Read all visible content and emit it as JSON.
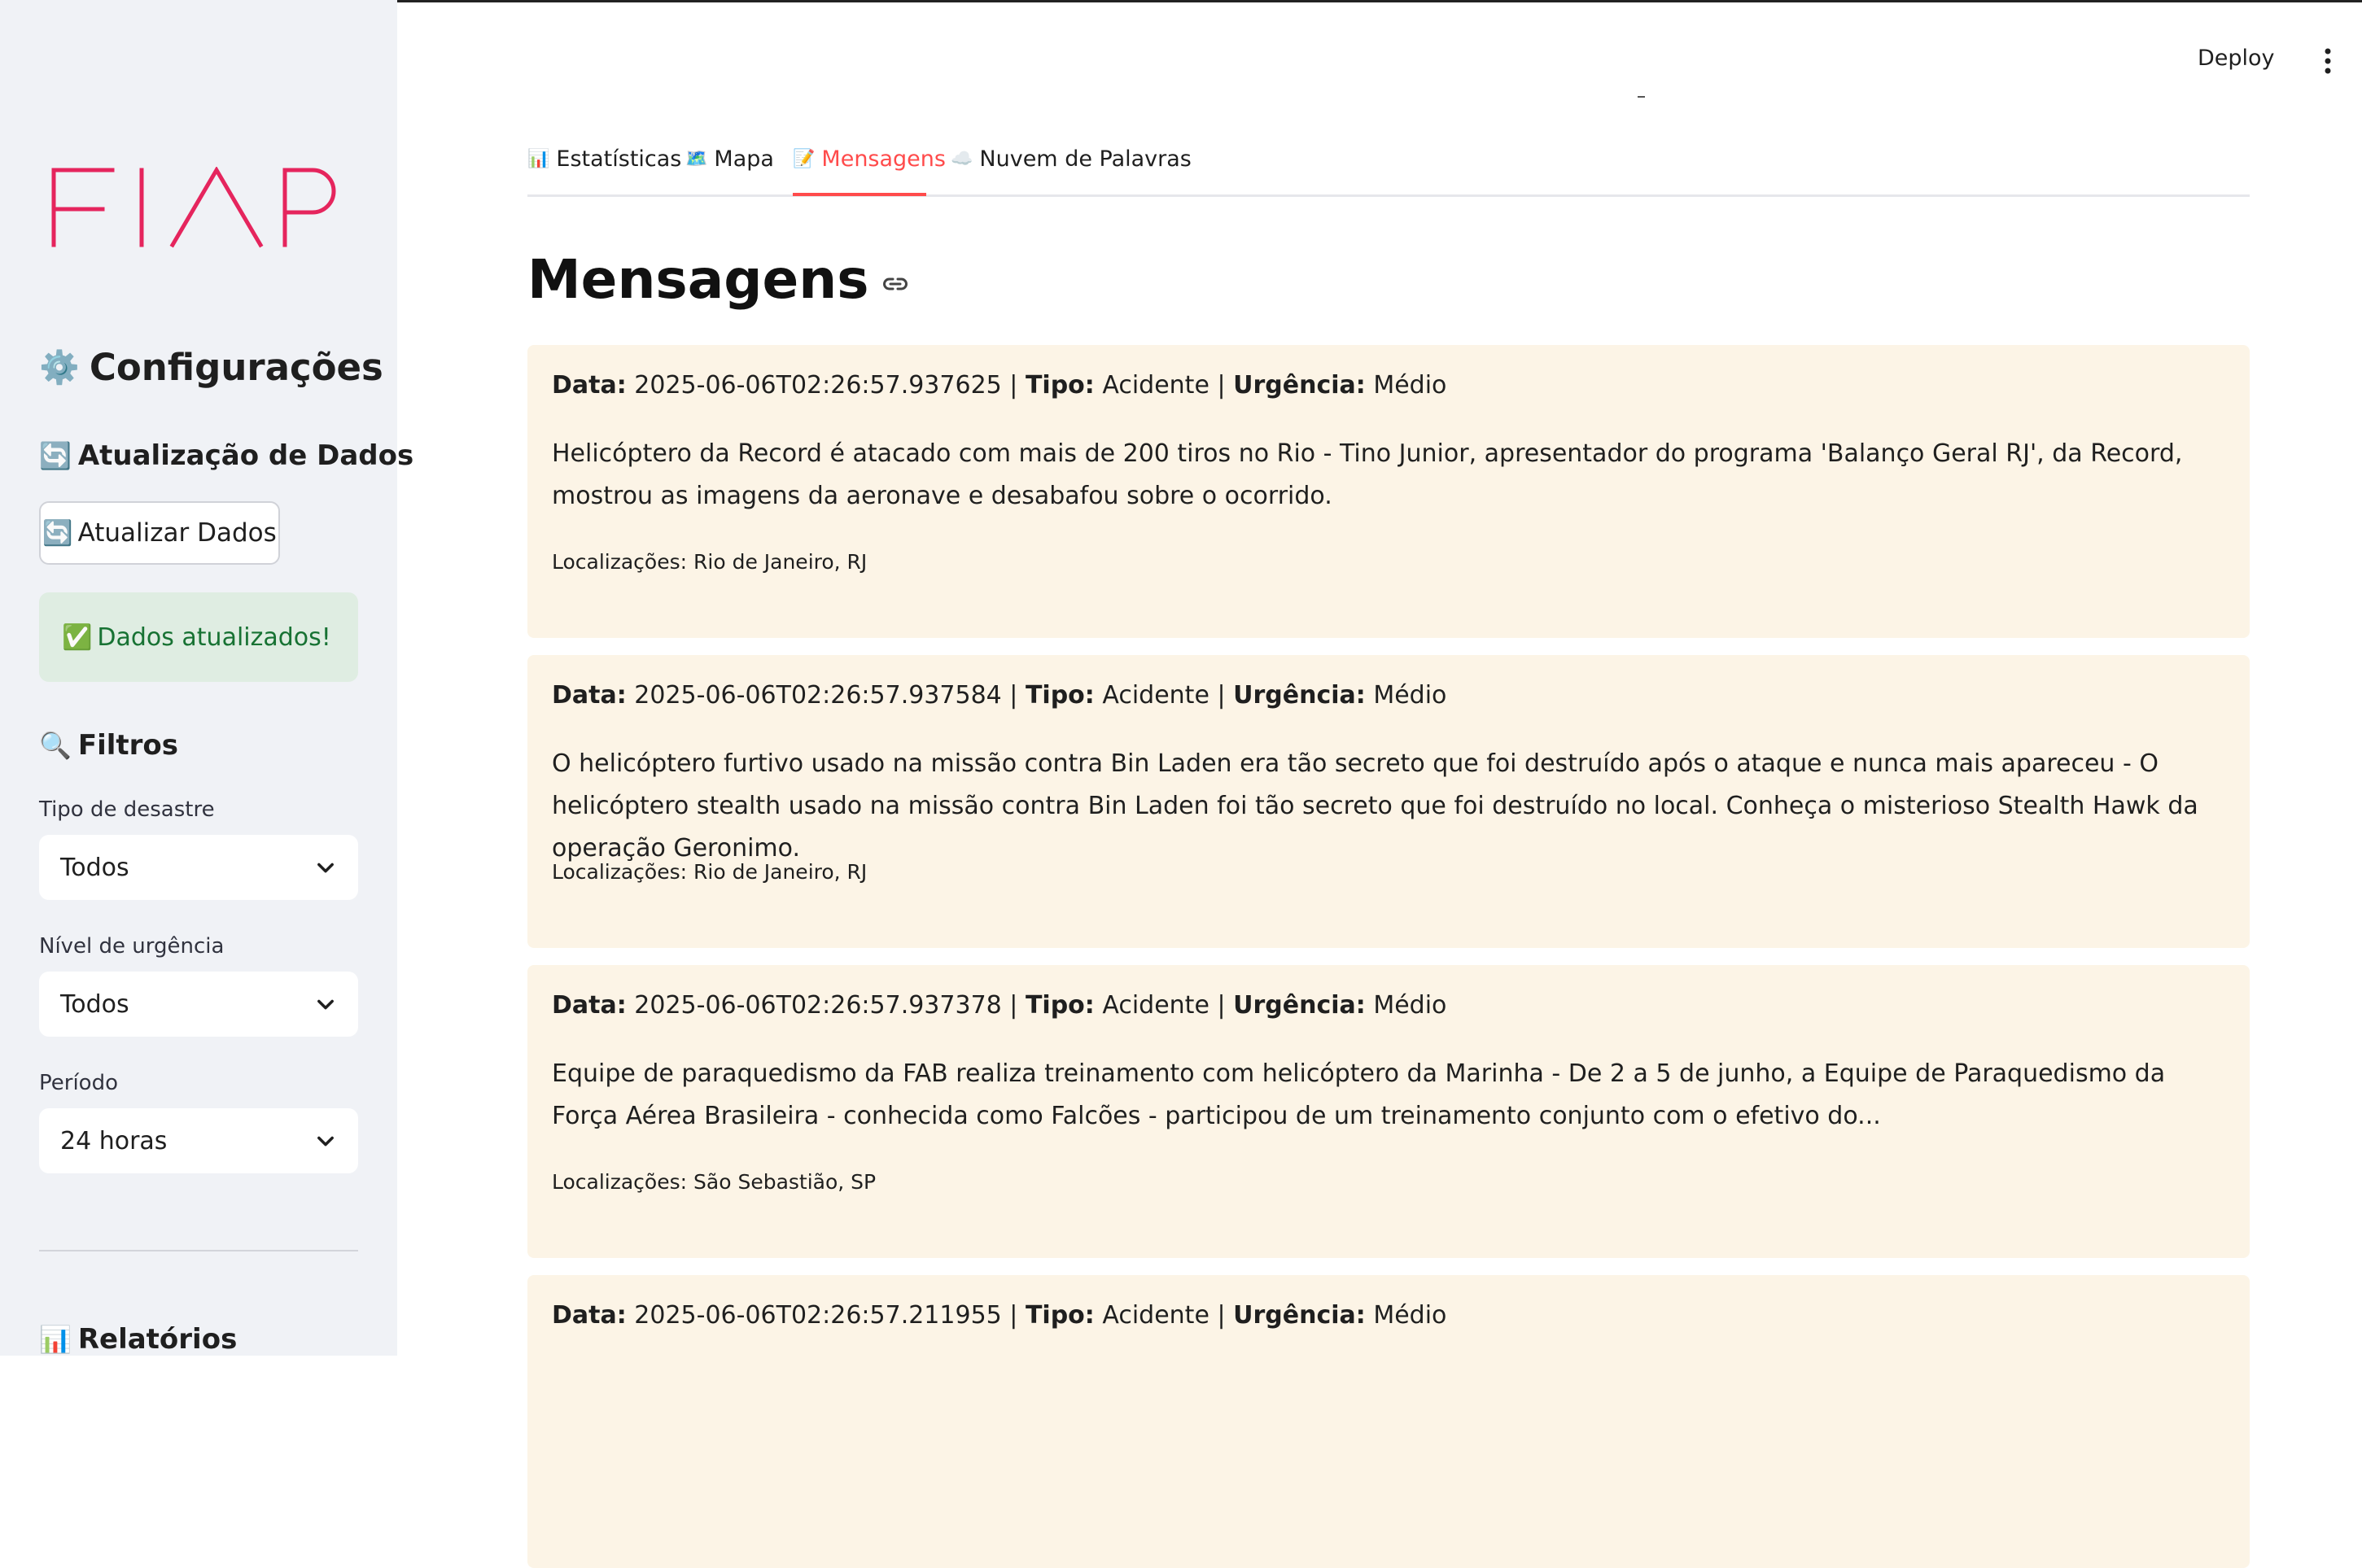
{
  "header": {
    "deploy_label": "Deploy",
    "menu_icon": "kebab-menu-icon"
  },
  "brand": {
    "logo_text": "FIAP",
    "logo_color": "#e5255d"
  },
  "sidebar": {
    "title": "Configurações",
    "title_icon": "⚙️",
    "update_section": {
      "icon": "🔄",
      "title": "Atualização de Dados"
    },
    "refresh_button": {
      "icon": "🔄",
      "label": "Atualizar Dados"
    },
    "success_alert": {
      "icon": "✅",
      "text": "Dados atualizados!"
    },
    "filters_section": {
      "icon": "🔍",
      "title": "Filtros"
    },
    "filters": [
      {
        "label": "Tipo de desastre",
        "value": "Todos"
      },
      {
        "label": "Nível de urgência",
        "value": "Todos"
      },
      {
        "label": "Período",
        "value": "24 horas"
      }
    ],
    "reports_section": {
      "icon": "📊",
      "title": "Relatórios"
    }
  },
  "tabs": [
    {
      "icon": "📊",
      "label": "Estatísticas",
      "active": false
    },
    {
      "icon": "🗺️",
      "label": "Mapa",
      "active": false
    },
    {
      "icon": "📝",
      "label": "Mensagens",
      "active": true
    },
    {
      "icon": "☁️",
      "label": "Nuvem de Palavras",
      "active": false
    }
  ],
  "main": {
    "title": "Mensagens",
    "labels": {
      "data": "Data:",
      "tipo": "Tipo:",
      "urgencia": "Urgência:",
      "sep": "|",
      "locations": "Localizações:"
    },
    "messages": [
      {
        "date": "2025-06-06T02:26:57.937625",
        "type": "Acidente",
        "urgency": "Médio",
        "text": "Helicóptero da Record é atacado com mais de 200 tiros no Rio - Tino Junior, apresentador do programa 'Balanço Geral RJ', da Record, mostrou as imagens da aeronave e desabafou sobre o ocorrido.",
        "locations": "Rio de Janeiro, RJ"
      },
      {
        "date": "2025-06-06T02:26:57.937584",
        "type": "Acidente",
        "urgency": "Médio",
        "text": "O helicóptero furtivo usado na missão contra Bin Laden era tão secreto que foi destruído após o ataque e nunca mais apareceu - O helicóptero stealth usado na missão contra Bin Laden foi tão secreto que foi destruído no local. Conheça o misterioso Stealth Hawk da operação Geronimo.",
        "locations": "Rio de Janeiro, RJ"
      },
      {
        "date": "2025-06-06T02:26:57.937378",
        "type": "Acidente",
        "urgency": "Médio",
        "text": "Equipe de paraquedismo da FAB realiza treinamento com helicóptero da Marinha - De 2 a 5 de junho, a Equipe de Paraquedismo da Força Aérea Brasileira - conhecida como Falcões - participou de um treinamento conjunto com o efetivo do...",
        "locations": "São Sebastião, SP"
      },
      {
        "date": "2025-06-06T02:26:57.211955",
        "type": "Acidente",
        "urgency": "Médio",
        "text": "",
        "locations": ""
      }
    ]
  },
  "colors": {
    "accent": "#ff4b4b",
    "sidebar_bg": "#f0f2f6",
    "card_bg": "#fcf4e6",
    "success_bg": "#dfede2",
    "success_text": "#177233"
  }
}
